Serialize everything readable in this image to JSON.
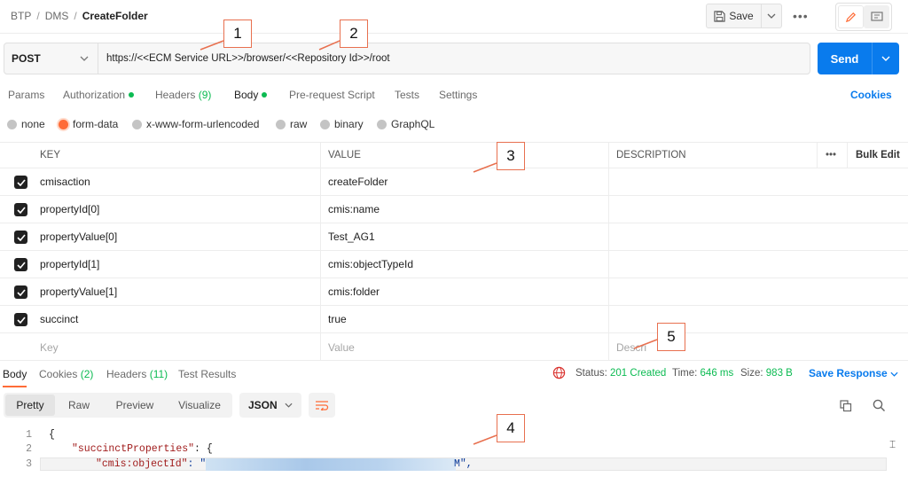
{
  "breadcrumb": {
    "part1": "BTP",
    "part2": "DMS",
    "current": "CreateFolder",
    "sep": "/"
  },
  "toolbar": {
    "save_label": "Save",
    "more": "•••"
  },
  "request": {
    "method": "POST",
    "url": "https://<<ECM Service URL>>/browser/<<Repository Id>>/root",
    "send_label": "Send"
  },
  "request_tabs": {
    "params": "Params",
    "authorization": "Authorization",
    "headers": "Headers",
    "headers_count": "(9)",
    "body": "Body",
    "prerequest": "Pre-request Script",
    "tests": "Tests",
    "settings": "Settings",
    "cookies": "Cookies"
  },
  "body_types": [
    "none",
    "form-data",
    "x-www-form-urlencoded",
    "raw",
    "binary",
    "GraphQL"
  ],
  "body_type_selected": "form-data",
  "kv_table": {
    "headers": {
      "key": "KEY",
      "value": "VALUE",
      "description": "DESCRIPTION",
      "more": "•••",
      "bulk": "Bulk Edit"
    },
    "rows": [
      {
        "key": "cmisaction",
        "value": "createFolder"
      },
      {
        "key": "propertyId[0]",
        "value": "cmis:name"
      },
      {
        "key": "propertyValue[0]",
        "value": "Test_AG1"
      },
      {
        "key": "propertyId[1]",
        "value": "cmis:objectTypeId"
      },
      {
        "key": "propertyValue[1]",
        "value": "cmis:folder"
      },
      {
        "key": "succinct",
        "value": "true"
      }
    ],
    "placeholders": {
      "key": "Key",
      "value": "Value",
      "description": "Descri"
    }
  },
  "response": {
    "tabs": {
      "body": "Body",
      "cookies": "Cookies",
      "cookies_count": "(2)",
      "headers": "Headers",
      "headers_count": "(11)",
      "tests": "Test Results"
    },
    "status_label": "Status:",
    "status_value": "201 Created",
    "time_label": "Time:",
    "time_value": "646 ms",
    "size_label": "Size:",
    "size_value": "983 B",
    "save_label": "Save Response",
    "views": {
      "pretty": "Pretty",
      "raw": "Raw",
      "preview": "Preview",
      "visualize": "Visualize"
    },
    "format": "JSON"
  },
  "code": {
    "line_numbers": [
      "1",
      "2",
      "3"
    ],
    "line1": "{",
    "line2_key": "\"succinctProperties\"",
    "line2_rest": ": {",
    "line3_key": "\"cmis:objectId\"",
    "line3_mid": ": \"C",
    "line3_end": "M\","
  },
  "callouts": [
    "1",
    "2",
    "3",
    "4",
    "5"
  ],
  "colors": {
    "accent": "#ff6c37",
    "primary": "#097bed",
    "success": "#0cbb52",
    "callout_border": "#e8704f"
  }
}
